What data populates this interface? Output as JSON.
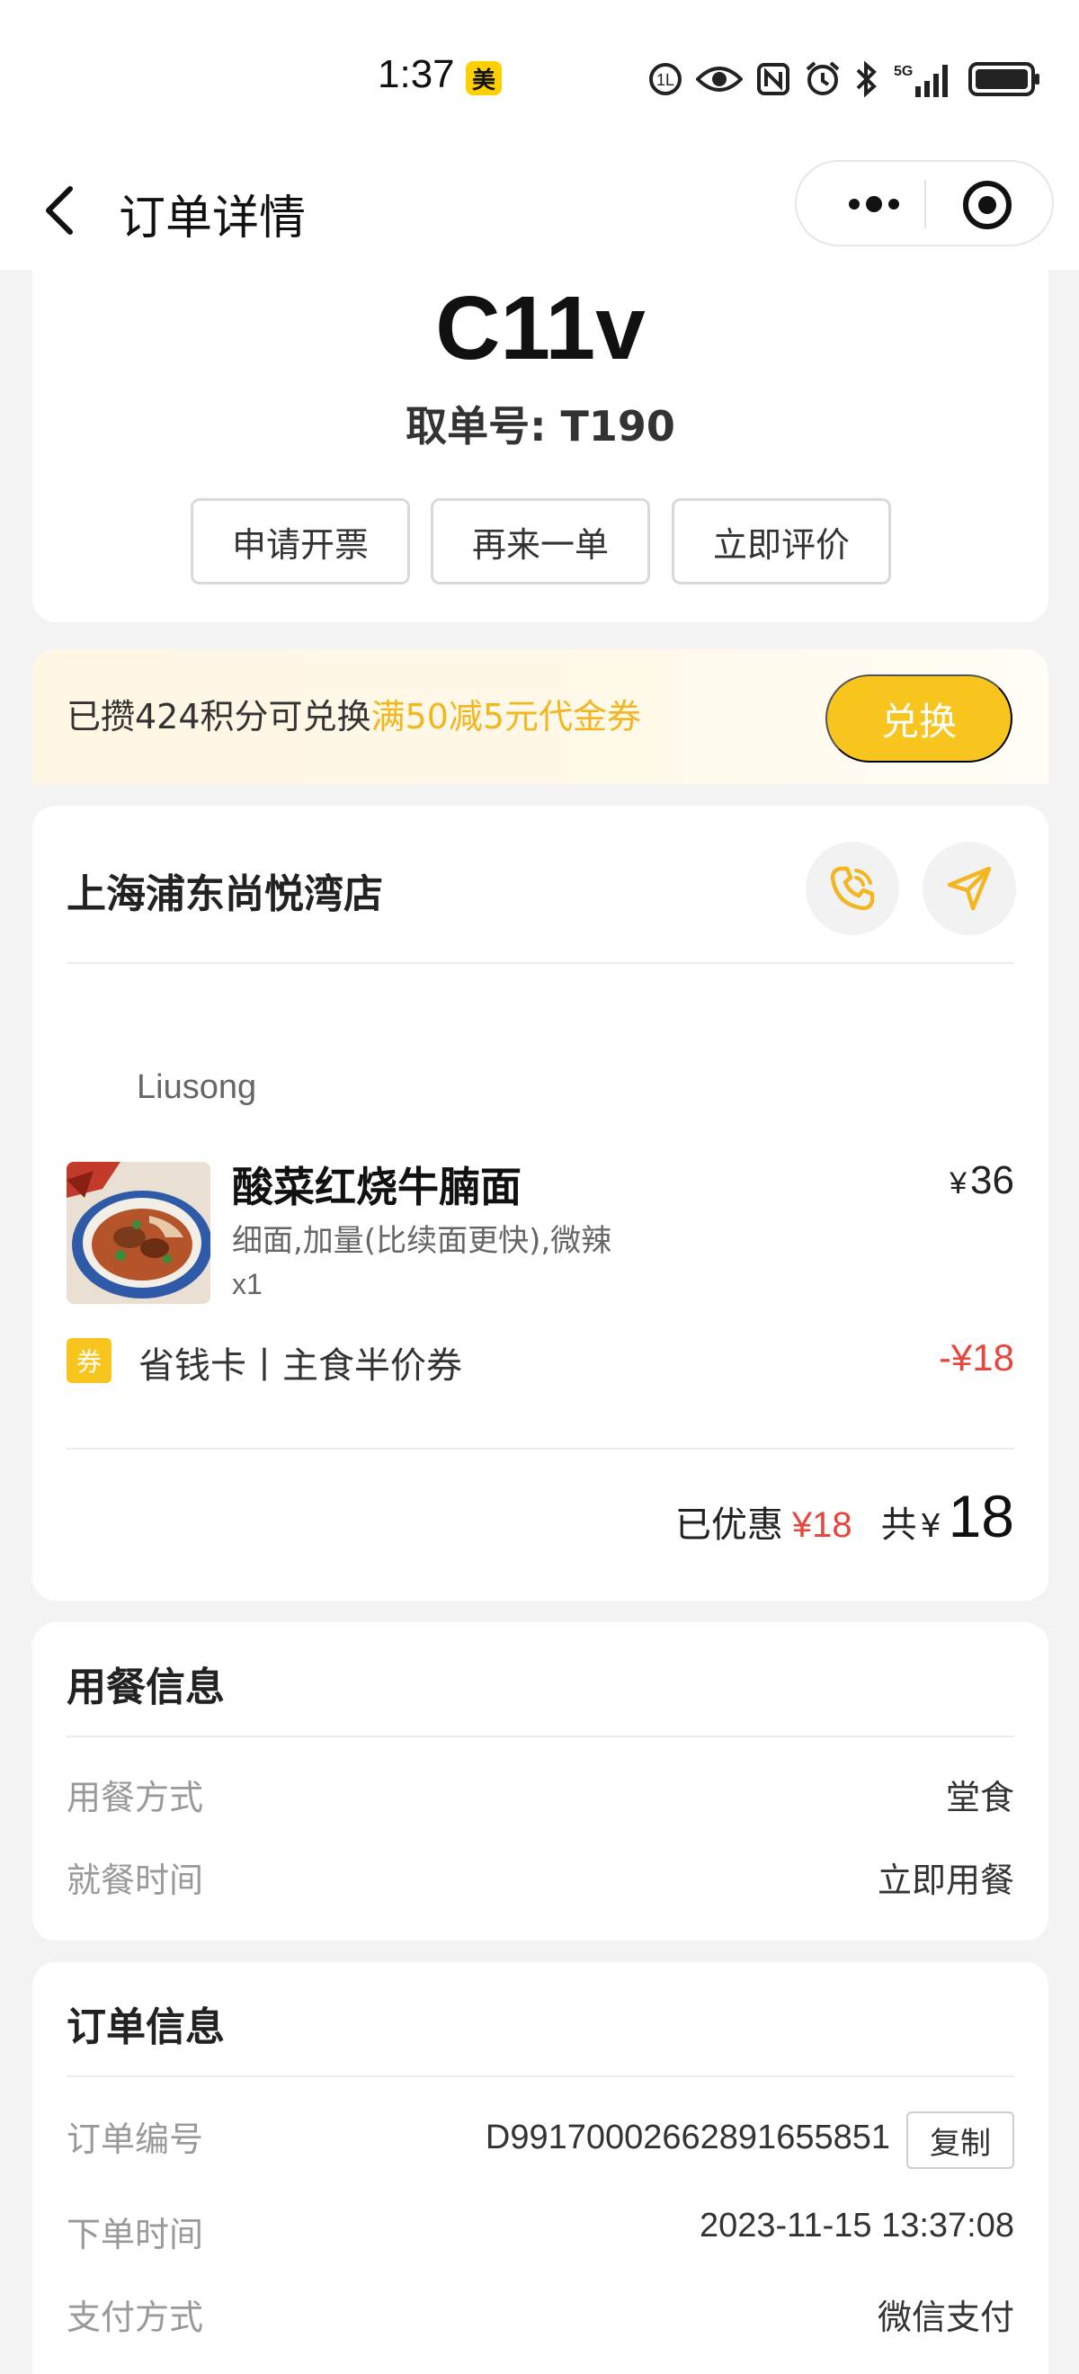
{
  "status_bar": {
    "time": "1:37",
    "badge": "美",
    "network": "5G"
  },
  "nav": {
    "title": "订单详情"
  },
  "order": {
    "code": "C11v",
    "pickup_label": "取单号: T190",
    "actions": [
      "申请开票",
      "再来一单",
      "立即评价"
    ]
  },
  "points_banner": {
    "text": "已攒424积分可兑换",
    "highlight": "满50减5元代金券",
    "button": "兑换",
    "accent_color": "#f2b720"
  },
  "store": {
    "name": "上海浦东尚悦湾店",
    "staff": "Liusong",
    "items": [
      {
        "name": "酸菜红烧牛腩面",
        "spec": "细面,加量(比续面更快),微辣",
        "qty": "x1",
        "price_symbol": "¥",
        "price": "36"
      }
    ],
    "coupon": {
      "tag": "券",
      "name": "省钱卡丨主食半价券",
      "amount": "-¥18"
    },
    "summary": {
      "saved_label": "已优惠",
      "saved_amount": "¥18",
      "total_label": "共",
      "total_symbol": "¥",
      "total_amount": "18"
    }
  },
  "dine_info": {
    "title": "用餐信息",
    "rows": [
      {
        "label": "用餐方式",
        "value": "堂食"
      },
      {
        "label": "就餐时间",
        "value": "立即用餐"
      }
    ]
  },
  "order_info": {
    "title": "订单信息",
    "copy_label": "复制",
    "rows": [
      {
        "label": "订单编号",
        "value": "D99170002662891655851"
      },
      {
        "label": "下单时间",
        "value": "2023-11-15 13:37:08"
      },
      {
        "label": "支付方式",
        "value": "微信支付"
      }
    ]
  },
  "colors": {
    "brand_yellow": "#f8c51e",
    "discount_red": "#e8453c",
    "background": "#f3f3f3"
  }
}
